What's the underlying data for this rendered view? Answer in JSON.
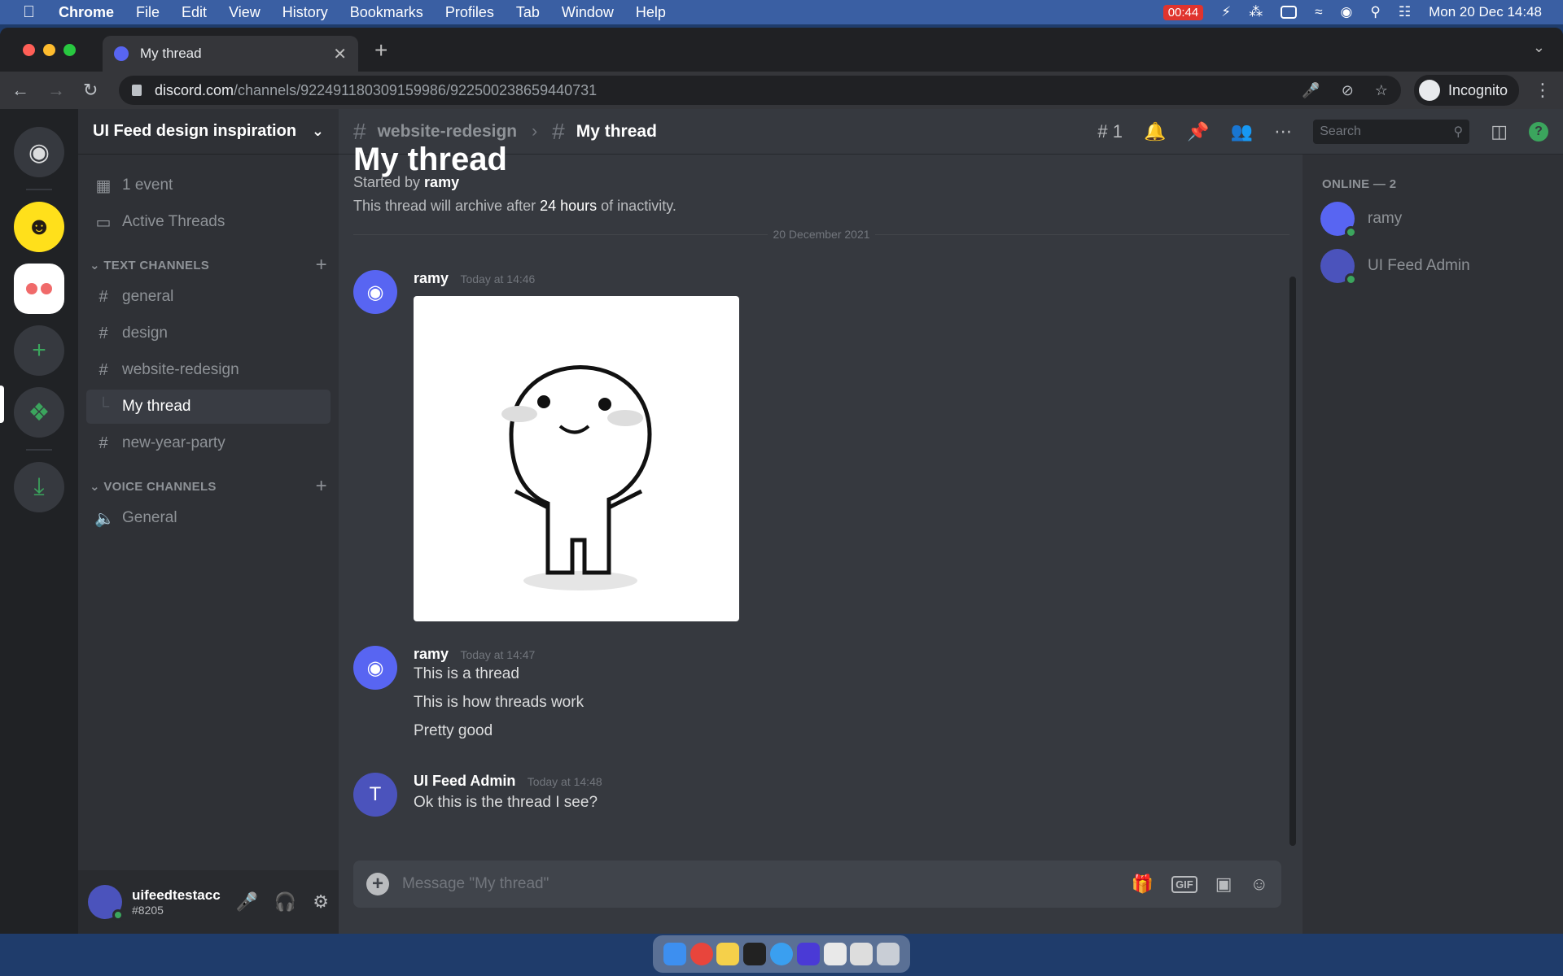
{
  "menubar": {
    "app": "Chrome",
    "items": [
      "File",
      "Edit",
      "View",
      "History",
      "Bookmarks",
      "Profiles",
      "Tab",
      "Window",
      "Help"
    ],
    "recording_time": "00:44",
    "datetime": "Mon 20 Dec  14:48"
  },
  "browser": {
    "tab_title": "My thread",
    "url_host": "discord.com",
    "url_path": "/channels/922491180309159986/922500238659440731",
    "profile_label": "Incognito"
  },
  "server": {
    "name": "UI Feed design inspiration",
    "events": "1 event",
    "active_threads": "Active Threads",
    "text_category": "TEXT CHANNELS",
    "text_channels": [
      "general",
      "design",
      "website-redesign",
      "My thread",
      "new-year-party"
    ],
    "voice_category": "VOICE CHANNELS",
    "voice_channels": [
      "General"
    ]
  },
  "user": {
    "name": "uifeedtestacc",
    "tag": "#8205"
  },
  "header": {
    "parent_channel": "website-redesign",
    "thread_name": "My thread",
    "threads_count": "1",
    "search_placeholder": "Search"
  },
  "intro": {
    "title": "My thread",
    "started_by_prefix": "Started by ",
    "started_by": "ramy",
    "archive_prefix": "This thread will archive after ",
    "archive_duration": "24 hours",
    "archive_suffix": " of inactivity."
  },
  "date_divider": "20 December 2021",
  "messages": [
    {
      "author": "ramy",
      "timestamp": "Today at 14:46",
      "lines": []
    },
    {
      "author": "ramy",
      "timestamp": "Today at 14:47",
      "lines": [
        "This is a thread",
        "This is how threads work",
        "Pretty good"
      ]
    },
    {
      "author": "UI Feed Admin",
      "timestamp": "Today at 14:48",
      "lines": [
        "Ok this is the thread I see?"
      ]
    }
  ],
  "composer": {
    "placeholder": "Message \"My thread\"",
    "gif_label": "GIF"
  },
  "members": {
    "category": "ONLINE — 2",
    "list": [
      "ramy",
      "UI Feed Admin"
    ]
  },
  "colors": {
    "blurple": "#5865f2",
    "online": "#3ba55d",
    "chat_bg": "#36393f",
    "sidebar_bg": "#2f3136"
  }
}
